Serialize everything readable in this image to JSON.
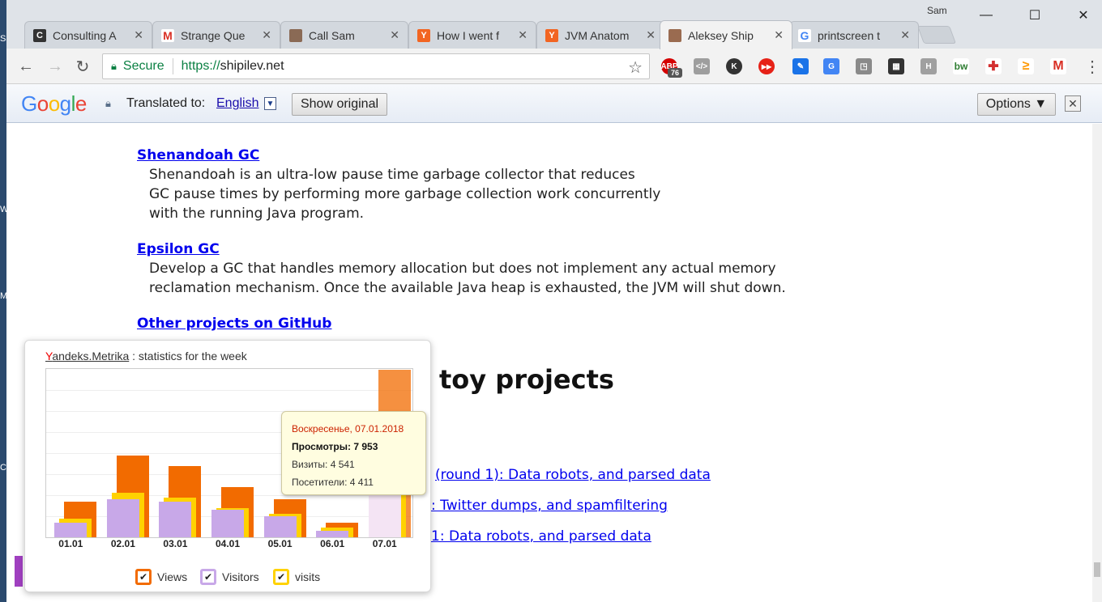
{
  "desktop": {
    "edge_chars": [
      "Sa",
      "W",
      "M",
      "C"
    ]
  },
  "window": {
    "user": "Sam",
    "controls": {
      "minimize": "—",
      "maximize": "☐",
      "close": "✕"
    }
  },
  "tabs": [
    {
      "label": "Consulting A",
      "icon": "C",
      "icon_bg": "#333333"
    },
    {
      "label": "Strange Que",
      "icon": "M",
      "icon_bg": "#ffffff"
    },
    {
      "label": "Call Sam",
      "icon": "",
      "icon_bg": "#8a6a55"
    },
    {
      "label": "How I went f",
      "icon": "Y",
      "icon_bg": "#f26522"
    },
    {
      "label": "JVM Anatom",
      "icon": "Y",
      "icon_bg": "#f26522"
    },
    {
      "label": "Aleksey Ship",
      "icon": "",
      "icon_bg": "#9a6b50"
    },
    {
      "label": "printscreen t",
      "icon": "G",
      "icon_bg": "#ffffff"
    }
  ],
  "toolbar": {
    "back": "←",
    "forward": "→",
    "reload": "↻",
    "secure_label": "Secure",
    "url_scheme": "https://",
    "url_host": "shipilev.net",
    "star": "☆",
    "menu": "⋮",
    "extensions": [
      {
        "name": "adblock-plus-icon",
        "text": "ABP",
        "bg": "#d40000",
        "badge": "76"
      },
      {
        "name": "code-icon",
        "text": "</>",
        "bg": "#9e9e9e"
      },
      {
        "name": "k-icon",
        "text": "K",
        "bg": "#333333"
      },
      {
        "name": "video-icon",
        "text": "▶▶",
        "bg": "#e62117"
      },
      {
        "name": "eyedropper-icon",
        "text": "✎",
        "bg": "#1a73e8"
      },
      {
        "name": "translate-icon",
        "text": "G",
        "bg": "#4285f4"
      },
      {
        "name": "screenshot-icon",
        "text": "◳",
        "bg": "#8a8a8a"
      },
      {
        "name": "film-icon",
        "text": "▦",
        "bg": "#333333"
      },
      {
        "name": "h-icon",
        "text": "H",
        "bg": "#a0a0a0"
      },
      {
        "name": "bw-icon",
        "text": "bw",
        "bg": "#2e7d32"
      },
      {
        "name": "plus-icon",
        "text": "✚",
        "bg": "#d32f2f"
      },
      {
        "name": "feed-icon",
        "text": "≥",
        "bg": "#ff9800"
      },
      {
        "name": "gmail-icon",
        "text": "M",
        "bg": "#d93025"
      }
    ]
  },
  "translate_bar": {
    "logo": [
      "G",
      "o",
      "o",
      "g",
      "l",
      "e"
    ],
    "translated_to": "Translated to:",
    "language": "English",
    "language_arrow": "▼",
    "show_original": "Show original",
    "options": "Options ▼",
    "close": "✕"
  },
  "page": {
    "projects": [
      {
        "title": "Shenandoah GC",
        "lines": [
          "Shenandoah is an ultra-low pause time garbage collector that reduces",
          "GC pause times by performing more garbage collection work concurrently",
          "with the running Java program."
        ]
      },
      {
        "title": "Epsilon GC",
        "lines": [
          "Develop a GC that handles memory allocation but does not implement any actual memory",
          "reclamation mechanism. Once the available Java heap is exhausted, the JVM will shut down."
        ]
      }
    ],
    "other_projects": "Other projects on GitHub",
    "heading_fragment": "toy projects",
    "links": [
      "(round 1): Data robots, and parsed data",
      ": Twitter dumps, and spamfiltering",
      "1: Data robots, and parsed data"
    ]
  },
  "yandex": {
    "brand_first": "Y",
    "brand_rest": "andeks.Metrika",
    "title_suffix": " : statistics for the week",
    "tooltip": {
      "date": "Воскресенье, 07.01.2018",
      "views": "Просмотры: 7 953",
      "visits": "Визиты: 4 541",
      "visitors": "Посетители: 4 411"
    },
    "legend": [
      {
        "label": "Views",
        "color": "#f26b00"
      },
      {
        "label": "Visitors",
        "color": "#c8a8e8"
      },
      {
        "label": "visits",
        "color": "#ffd200"
      }
    ],
    "checkmark": "✔"
  },
  "chart_data": {
    "type": "bar",
    "categories": [
      "01.01",
      "02.01",
      "03.01",
      "04.01",
      "05.01",
      "06.01",
      "07.01"
    ],
    "series": [
      {
        "name": "Views",
        "color": "#f26b00",
        "values": [
          1700,
          3900,
          3400,
          2400,
          1800,
          700,
          7953
        ]
      },
      {
        "name": "visits",
        "color": "#ffd200",
        "values": [
          900,
          2100,
          1900,
          1400,
          1100,
          450,
          4541
        ]
      },
      {
        "name": "Visitors",
        "color": "#c8a8e8",
        "values": [
          700,
          1800,
          1700,
          1300,
          1000,
          300,
          4411
        ]
      }
    ],
    "ylim": [
      0,
      8000
    ],
    "grid": true,
    "legend_position": "bottom"
  }
}
